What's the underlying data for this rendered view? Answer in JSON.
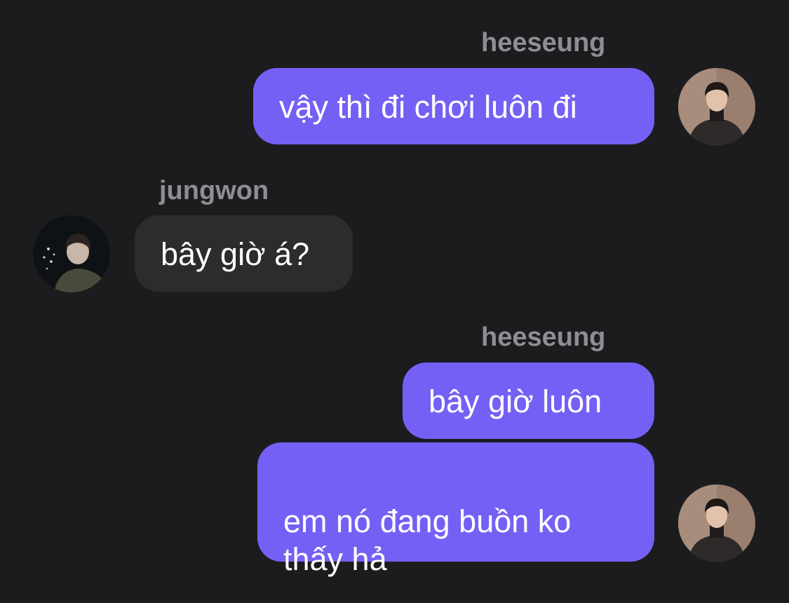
{
  "messages": [
    {
      "sender": "heeseung",
      "side": "outgoing",
      "avatar": "heeseung-avatar",
      "bubbles": [
        "vậy thì đi chơi luôn đi"
      ]
    },
    {
      "sender": "jungwon",
      "side": "incoming",
      "avatar": "jungwon-avatar",
      "bubbles": [
        "bây giờ á?"
      ]
    },
    {
      "sender": "heeseung",
      "side": "outgoing",
      "avatar": "heeseung-avatar",
      "bubbles": [
        "bây giờ luôn",
        "em nó đang buồn ko\nthấy hả"
      ]
    }
  ],
  "colors": {
    "background": "#1c1c1e",
    "outgoing_bubble": "#7560f5",
    "incoming_bubble": "#2c2c2e",
    "sender_name": "#8e8e93",
    "message_text": "#ffffff"
  }
}
